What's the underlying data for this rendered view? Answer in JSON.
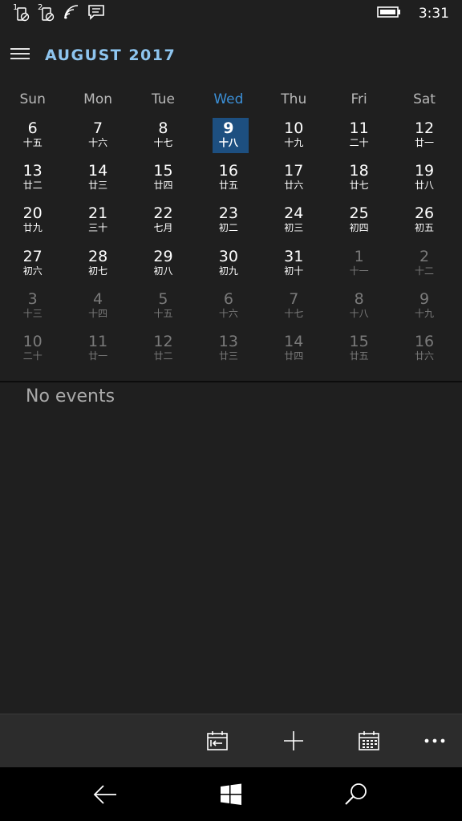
{
  "status_bar": {
    "sim1_label": "1",
    "sim2_label": "2",
    "time": "3:31"
  },
  "header": {
    "month_title": "AUGUST 2017"
  },
  "weekdays": [
    "Sun",
    "Mon",
    "Tue",
    "Wed",
    "Thu",
    "Fri",
    "Sat"
  ],
  "today_weekday_index": 3,
  "weeks": [
    [
      {
        "day": "6",
        "lunar": "十五",
        "current": true
      },
      {
        "day": "7",
        "lunar": "十六",
        "current": true
      },
      {
        "day": "8",
        "lunar": "十七",
        "current": true
      },
      {
        "day": "9",
        "lunar": "十八",
        "current": true,
        "selected": true
      },
      {
        "day": "10",
        "lunar": "十九",
        "current": true
      },
      {
        "day": "11",
        "lunar": "二十",
        "current": true
      },
      {
        "day": "12",
        "lunar": "廿一",
        "current": true
      }
    ],
    [
      {
        "day": "13",
        "lunar": "廿二",
        "current": true
      },
      {
        "day": "14",
        "lunar": "廿三",
        "current": true
      },
      {
        "day": "15",
        "lunar": "廿四",
        "current": true
      },
      {
        "day": "16",
        "lunar": "廿五",
        "current": true
      },
      {
        "day": "17",
        "lunar": "廿六",
        "current": true
      },
      {
        "day": "18",
        "lunar": "廿七",
        "current": true
      },
      {
        "day": "19",
        "lunar": "廿八",
        "current": true
      }
    ],
    [
      {
        "day": "20",
        "lunar": "廿九",
        "current": true
      },
      {
        "day": "21",
        "lunar": "三十",
        "current": true
      },
      {
        "day": "22",
        "lunar": "七月",
        "current": true
      },
      {
        "day": "23",
        "lunar": "初二",
        "current": true
      },
      {
        "day": "24",
        "lunar": "初三",
        "current": true
      },
      {
        "day": "25",
        "lunar": "初四",
        "current": true
      },
      {
        "day": "26",
        "lunar": "初五",
        "current": true
      }
    ],
    [
      {
        "day": "27",
        "lunar": "初六",
        "current": true
      },
      {
        "day": "28",
        "lunar": "初七",
        "current": true
      },
      {
        "day": "29",
        "lunar": "初八",
        "current": true
      },
      {
        "day": "30",
        "lunar": "初九",
        "current": true
      },
      {
        "day": "31",
        "lunar": "初十",
        "current": true
      },
      {
        "day": "1",
        "lunar": "十一",
        "current": false
      },
      {
        "day": "2",
        "lunar": "十二",
        "current": false
      }
    ],
    [
      {
        "day": "3",
        "lunar": "十三",
        "current": false
      },
      {
        "day": "4",
        "lunar": "十四",
        "current": false
      },
      {
        "day": "5",
        "lunar": "十五",
        "current": false
      },
      {
        "day": "6",
        "lunar": "十六",
        "current": false
      },
      {
        "day": "7",
        "lunar": "十七",
        "current": false
      },
      {
        "day": "8",
        "lunar": "十八",
        "current": false
      },
      {
        "day": "9",
        "lunar": "十九",
        "current": false
      }
    ],
    [
      {
        "day": "10",
        "lunar": "二十",
        "current": false
      },
      {
        "day": "11",
        "lunar": "廿一",
        "current": false
      },
      {
        "day": "12",
        "lunar": "廿二",
        "current": false
      },
      {
        "day": "13",
        "lunar": "廿三",
        "current": false
      },
      {
        "day": "14",
        "lunar": "廿四",
        "current": false
      },
      {
        "day": "15",
        "lunar": "廿五",
        "current": false
      },
      {
        "day": "16",
        "lunar": "廿六",
        "current": false
      }
    ]
  ],
  "events": {
    "empty_text": "No events"
  },
  "app_bar": {
    "buttons": [
      "today-icon",
      "add-icon",
      "month-view-icon",
      "more-icon"
    ]
  },
  "nav_bar": {
    "buttons": [
      "back-icon",
      "windows-start-icon",
      "search-icon"
    ]
  },
  "colors": {
    "accent": "#3b8fd6",
    "title": "#8ec5ef",
    "selected_bg": "#1d4f80",
    "background": "#1f1f1f",
    "app_bar": "#2c2c2c",
    "muted_text": "#7a7a7a"
  }
}
